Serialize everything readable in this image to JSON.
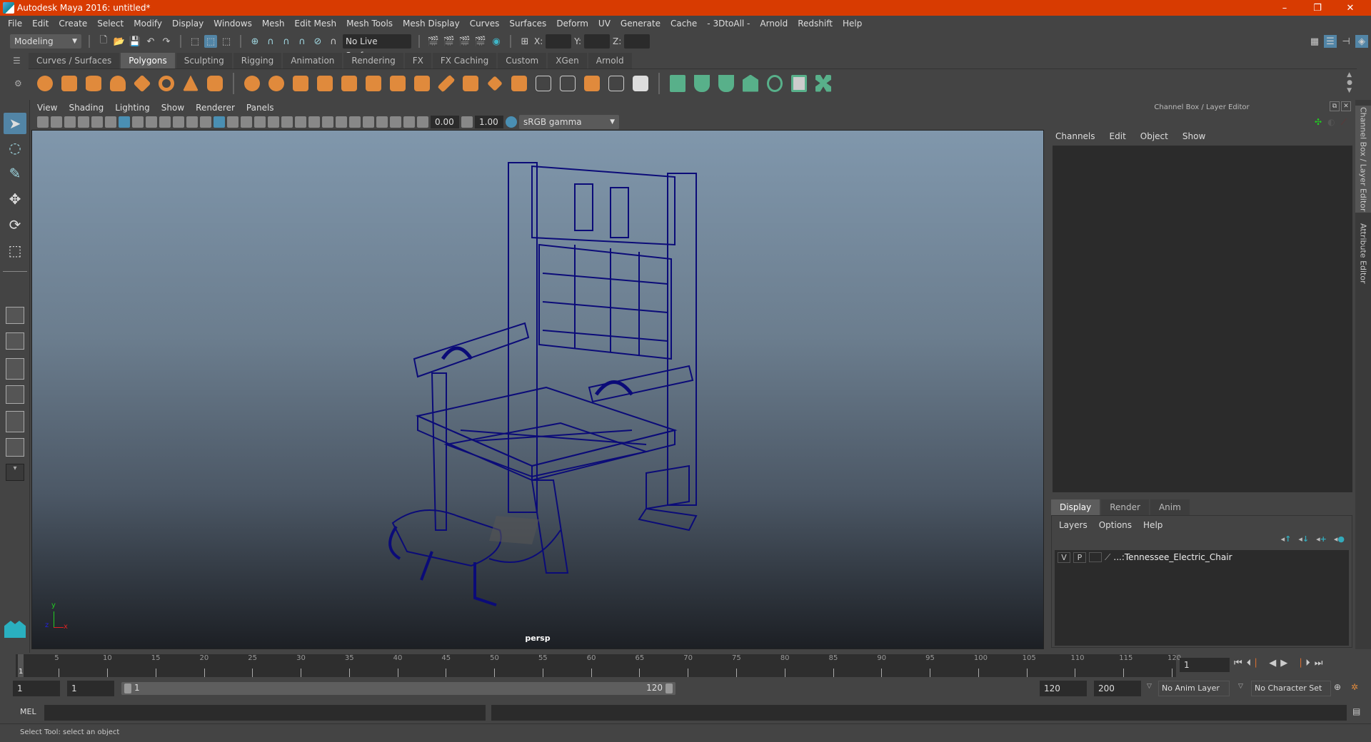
{
  "window": {
    "title": "Autodesk Maya 2016: untitled*",
    "minimize": "–",
    "maximize": "❐",
    "close": "✕"
  },
  "menu": [
    "File",
    "Edit",
    "Create",
    "Select",
    "Modify",
    "Display",
    "Windows",
    "Mesh",
    "Edit Mesh",
    "Mesh Tools",
    "Mesh Display",
    "Curves",
    "Surfaces",
    "Deform",
    "UV",
    "Generate",
    "Cache",
    "- 3DtoAll -",
    "Arnold",
    "Redshift",
    "Help"
  ],
  "statusline": {
    "mode": "Modeling",
    "live_surface": "No Live Surface",
    "x_label": "X:",
    "y_label": "Y:",
    "z_label": "Z:",
    "x_value": "",
    "y_value": "",
    "z_value": ""
  },
  "shelf": {
    "tabs": [
      "Curves / Surfaces",
      "Polygons",
      "Sculpting",
      "Rigging",
      "Animation",
      "Rendering",
      "FX",
      "FX Caching",
      "Custom",
      "XGen",
      "Arnold"
    ],
    "active_tab": "Polygons",
    "icons": [
      "poly-sphere",
      "poly-cube",
      "poly-cylinder",
      "poly-cone",
      "poly-plane",
      "poly-torus",
      "poly-pyramid",
      "poly-pipe",
      "combine",
      "separate",
      "mirror",
      "smooth",
      "extrude",
      "bevel",
      "bridge",
      "append",
      "multi-cut",
      "insert-edge-loop",
      "offset-edge-loop",
      "merge",
      "target-weld",
      "connect",
      "collapse",
      "automatic-uv",
      "planar-uv",
      "cylindrical-uv",
      "spherical-uv",
      "uv-editor",
      "uv-layout",
      "uv-tool"
    ]
  },
  "viewport": {
    "menu": [
      "View",
      "Shading",
      "Lighting",
      "Show",
      "Renderer",
      "Panels"
    ],
    "exposure": "0.00",
    "gamma": "1.00",
    "color_space": "sRGB gamma",
    "camera_label": "persp",
    "axis": {
      "x": "x",
      "y": "y",
      "z": "z"
    },
    "wireframe_color": "#0b0b78"
  },
  "channel_box": {
    "title": "Channel Box / Layer Editor",
    "menu": [
      "Channels",
      "Edit",
      "Object",
      "Show"
    ]
  },
  "layer_editor": {
    "tabs": [
      "Display",
      "Render",
      "Anim"
    ],
    "active_tab": "Display",
    "menu": [
      "Layers",
      "Options",
      "Help"
    ],
    "layers": [
      {
        "visible": "V",
        "playback": "P",
        "name": "...:Tennessee_Electric_Chair"
      }
    ]
  },
  "side_tabs": [
    "Channel Box / Layer Editor",
    "Attribute Editor"
  ],
  "timeline": {
    "ticks": [
      5,
      10,
      15,
      20,
      25,
      30,
      35,
      40,
      45,
      50,
      55,
      60,
      65,
      70,
      75,
      80,
      85,
      90,
      95,
      100,
      105,
      110,
      115,
      120
    ],
    "current_frame": "1",
    "current_frame_field": "1",
    "range_start": 1,
    "range_end": 120
  },
  "range": {
    "start_time": "1",
    "playback_start": "1",
    "slider_start_label": "1",
    "slider_end_label": "120",
    "playback_end": "120",
    "end_time": "200",
    "anim_layer": "No Anim Layer",
    "character_set": "No Character Set"
  },
  "command_line": {
    "label": "MEL",
    "value": "",
    "result": ""
  },
  "help_line": "Select Tool: select an object",
  "colors": {
    "titlebar": "#d83b01",
    "accent": "#5285a6",
    "shelf_orange": "#e08a3c",
    "shelf_green": "#58b08a"
  }
}
